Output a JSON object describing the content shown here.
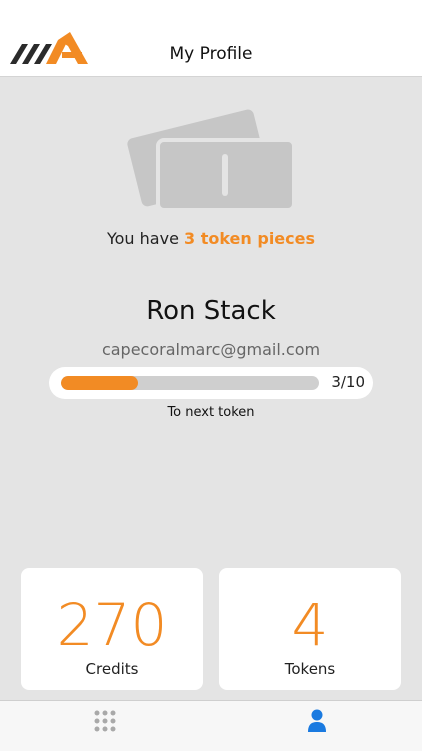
{
  "header": {
    "title": "My Profile",
    "logo_icon": "brand-logo-icon"
  },
  "colors": {
    "accent": "#f28b24",
    "background": "#e4e4e4",
    "tab_active": "#1a7ae0",
    "tab_inactive": "#a9a9a9"
  },
  "tokens_summary": {
    "prefix": "You have ",
    "highlight": "3 token pieces",
    "icon": "tickets-icon"
  },
  "user": {
    "name": "Ron Stack",
    "email": "capecoralmarc@gmail.com"
  },
  "progress": {
    "current": 3,
    "total": 10,
    "label": "3/10",
    "caption": "To next token"
  },
  "stats": {
    "credits": {
      "value": "270",
      "label": "Credits"
    },
    "tokens": {
      "value": "4",
      "label": "Tokens"
    }
  },
  "tabbar": {
    "items": [
      {
        "icon": "grid-icon",
        "active": false
      },
      {
        "icon": "user-icon",
        "active": true
      }
    ]
  }
}
